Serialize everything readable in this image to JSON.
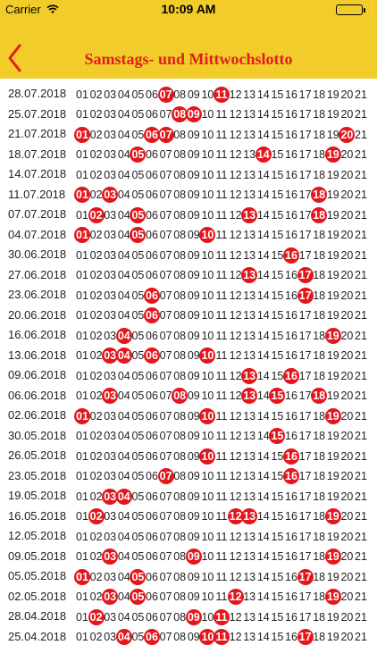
{
  "status_bar": {
    "carrier": "Carrier",
    "time": "10:09 AM"
  },
  "header": {
    "title": "Samstags- und Mittwochslotto"
  },
  "numbers": [
    "01",
    "02",
    "03",
    "04",
    "05",
    "06",
    "07",
    "08",
    "09",
    "10",
    "11",
    "12",
    "13",
    "14",
    "15",
    "16",
    "17",
    "18",
    "19",
    "20",
    "21"
  ],
  "draws": [
    {
      "date": "28.07.2018",
      "hits": [
        "07",
        "11"
      ]
    },
    {
      "date": "25.07.2018",
      "hits": [
        "08",
        "09"
      ]
    },
    {
      "date": "21.07.2018",
      "hits": [
        "01",
        "06",
        "07",
        "20"
      ]
    },
    {
      "date": "18.07.2018",
      "hits": [
        "05",
        "14",
        "19"
      ]
    },
    {
      "date": "14.07.2018",
      "hits": []
    },
    {
      "date": "11.07.2018",
      "hits": [
        "01",
        "03",
        "18"
      ]
    },
    {
      "date": "07.07.2018",
      "hits": [
        "02",
        "05",
        "13",
        "18"
      ]
    },
    {
      "date": "04.07.2018",
      "hits": [
        "01",
        "05",
        "10"
      ]
    },
    {
      "date": "30.06.2018",
      "hits": [
        "16"
      ]
    },
    {
      "date": "27.06.2018",
      "hits": [
        "13",
        "17"
      ]
    },
    {
      "date": "23.06.2018",
      "hits": [
        "06",
        "17"
      ]
    },
    {
      "date": "20.06.2018",
      "hits": [
        "06"
      ]
    },
    {
      "date": "16.06.2018",
      "hits": [
        "04",
        "19"
      ]
    },
    {
      "date": "13.06.2018",
      "hits": [
        "03",
        "04",
        "06",
        "10"
      ]
    },
    {
      "date": "09.06.2018",
      "hits": [
        "13",
        "16"
      ]
    },
    {
      "date": "06.06.2018",
      "hits": [
        "03",
        "08",
        "13",
        "15",
        "18"
      ]
    },
    {
      "date": "02.06.2018",
      "hits": [
        "01",
        "10",
        "19"
      ]
    },
    {
      "date": "30.05.2018",
      "hits": [
        "15"
      ]
    },
    {
      "date": "26.05.2018",
      "hits": [
        "10",
        "16"
      ]
    },
    {
      "date": "23.05.2018",
      "hits": [
        "07",
        "16"
      ]
    },
    {
      "date": "19.05.2018",
      "hits": [
        "03",
        "04"
      ]
    },
    {
      "date": "16.05.2018",
      "hits": [
        "02",
        "12",
        "13",
        "19"
      ]
    },
    {
      "date": "12.05.2018",
      "hits": []
    },
    {
      "date": "09.05.2018",
      "hits": [
        "03",
        "09",
        "19"
      ]
    },
    {
      "date": "05.05.2018",
      "hits": [
        "01",
        "05",
        "17"
      ]
    },
    {
      "date": "02.05.2018",
      "hits": [
        "03",
        "05",
        "12",
        "19"
      ]
    },
    {
      "date": "28.04.2018",
      "hits": [
        "02",
        "09",
        "11"
      ]
    },
    {
      "date": "25.04.2018",
      "hits": [
        "04",
        "06",
        "10",
        "11",
        "17"
      ]
    }
  ],
  "colors": {
    "header_bg": "#f2cc2b",
    "accent": "#e21c1c",
    "hit_bg": "#e3161c"
  },
  "icons": {
    "back": "chevron-left-icon",
    "wifi": "wifi-icon",
    "battery": "battery-icon"
  }
}
